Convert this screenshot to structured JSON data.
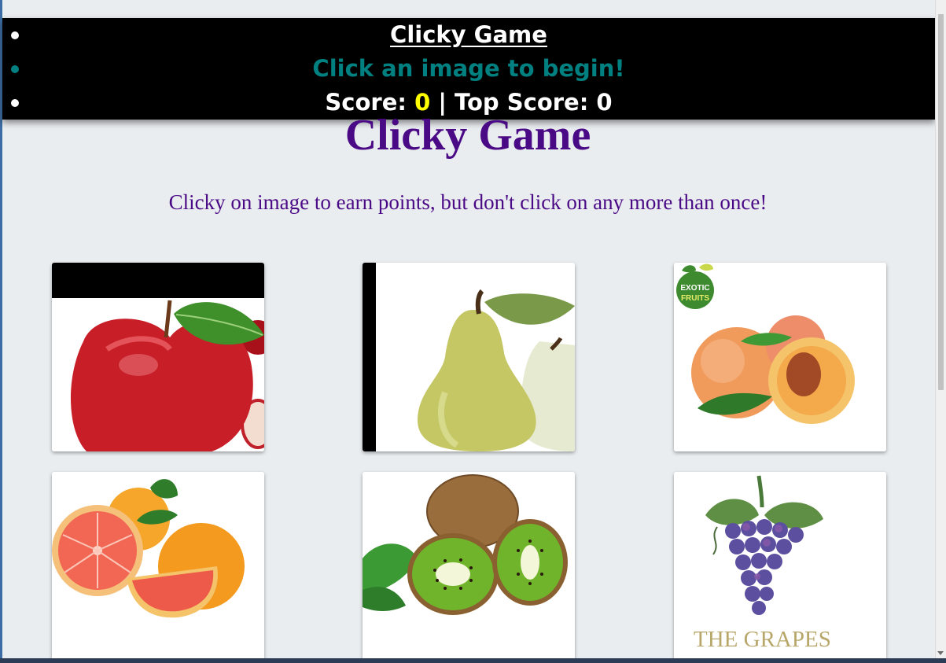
{
  "navbar": {
    "brand": "Clicky Game",
    "message": "Click an image to begin!",
    "score_label": "Score: ",
    "score": "0",
    "separator": " | ",
    "top_score_label": "Top Score: ",
    "top_score": "0"
  },
  "header": {
    "title": "Clicky Game",
    "subtitle": "Clicky on image to earn points, but don't click on any more than once!"
  },
  "cards": [
    {
      "fruit": "apple"
    },
    {
      "fruit": "pear"
    },
    {
      "fruit": "peach",
      "badge_line1": "EXOTIC",
      "badge_line2": "FRUITS"
    },
    {
      "fruit": "grapefruit"
    },
    {
      "fruit": "kiwi"
    },
    {
      "fruit": "grapes",
      "caption": "THE GRAPES"
    }
  ],
  "colors": {
    "title": "#4b0a85",
    "message": "#008080",
    "score_value": "#ffff00",
    "navbar_bg": "#000000",
    "page_bg": "#e9edf0"
  }
}
